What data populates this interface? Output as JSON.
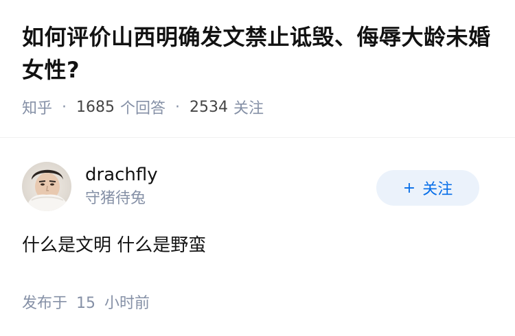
{
  "question": {
    "title": "如何评价山西明确发文禁止诋毁、侮辱大龄未婚女性?",
    "source": "知乎",
    "answer_count": "1685",
    "answer_label": "个回答",
    "follower_count": "2534",
    "follower_label": "关注"
  },
  "answer": {
    "author": {
      "name": "drachfly",
      "bio": "守猪待兔",
      "avatar_icon": "avatar-portrait-icon"
    },
    "follow_button": {
      "icon": "+",
      "label": "关注"
    },
    "content": "什么是文明 什么是野蛮",
    "time_prefix": "发布于",
    "time_value": "15",
    "time_unit": "小时前"
  },
  "colors": {
    "title": "#121212",
    "meta": "#8590a6",
    "accent": "#056de8",
    "follow_bg": "#ebf2fb"
  }
}
